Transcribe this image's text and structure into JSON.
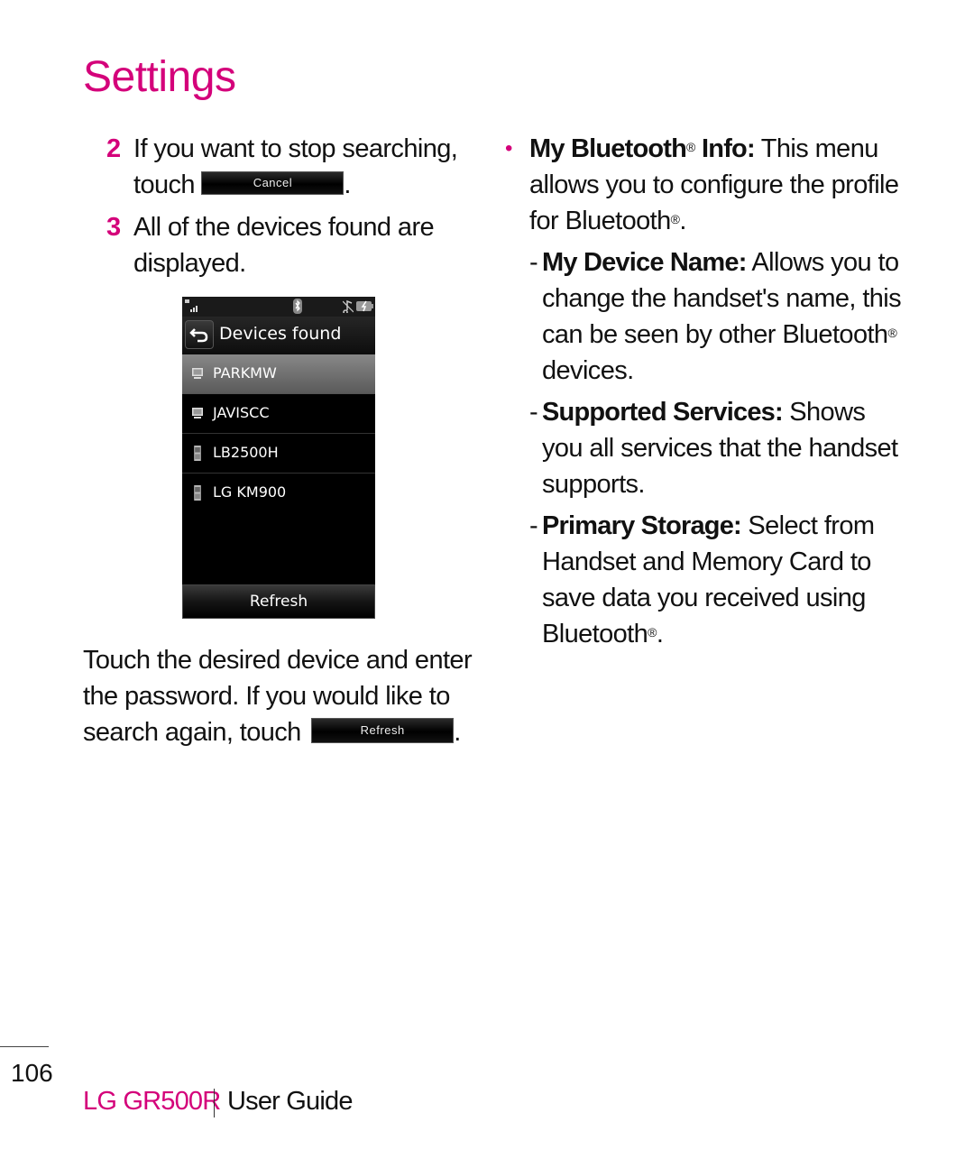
{
  "page": {
    "title": "Settings",
    "page_number": "106",
    "footer_brand": "LG GR500R",
    "footer_label": "User Guide"
  },
  "colors": {
    "accent": "#d4007a",
    "text": "#111111"
  },
  "steps": [
    {
      "num": "2",
      "text_before": "If you want to stop searching, touch",
      "button_label": "Cancel",
      "text_after": "."
    },
    {
      "num": "3",
      "text": "All of the devices found are displayed."
    }
  ],
  "phone": {
    "status_icons": [
      "signal-icon",
      "bluetooth-icon",
      "music-icon",
      "battery-icon"
    ],
    "header_title": "Devices found",
    "back_icon": "back-arrow-icon",
    "devices": [
      {
        "name": "PARKMW",
        "type": "computer",
        "icon": "computer-icon",
        "selected": true
      },
      {
        "name": "JAVISCC",
        "type": "computer",
        "icon": "computer-icon",
        "selected": false
      },
      {
        "name": "LB2500H",
        "type": "phone",
        "icon": "phone-icon",
        "selected": false
      },
      {
        "name": "LG KM900",
        "type": "phone",
        "icon": "phone-icon",
        "selected": false
      }
    ],
    "refresh_label": "Refresh"
  },
  "paragraph": {
    "text_before": "Touch the desired device and enter the password. If you would like to search again, touch",
    "button_label": "Refresh",
    "text_after": "."
  },
  "right": {
    "bullet": {
      "bold": "My Bluetooth",
      "reg": "®",
      "bold2": " Info:",
      "text": " This menu allows you to configure the profile for Bluetooth",
      "text_reg": "®",
      "text_end": "."
    },
    "subitems": [
      {
        "bold": "My Device Name:",
        "text": " Allows you to change the handset's name, this can be seen by other Bluetooth",
        "reg": "®",
        "end": " devices."
      },
      {
        "bold": "Supported Services:",
        "text": " Shows you all services that the handset supports.",
        "reg": "",
        "end": ""
      },
      {
        "bold": "Primary Storage:",
        "text": " Select from Handset and Memory Card to save data you received using Bluetooth",
        "reg": "®",
        "end": "."
      }
    ]
  }
}
